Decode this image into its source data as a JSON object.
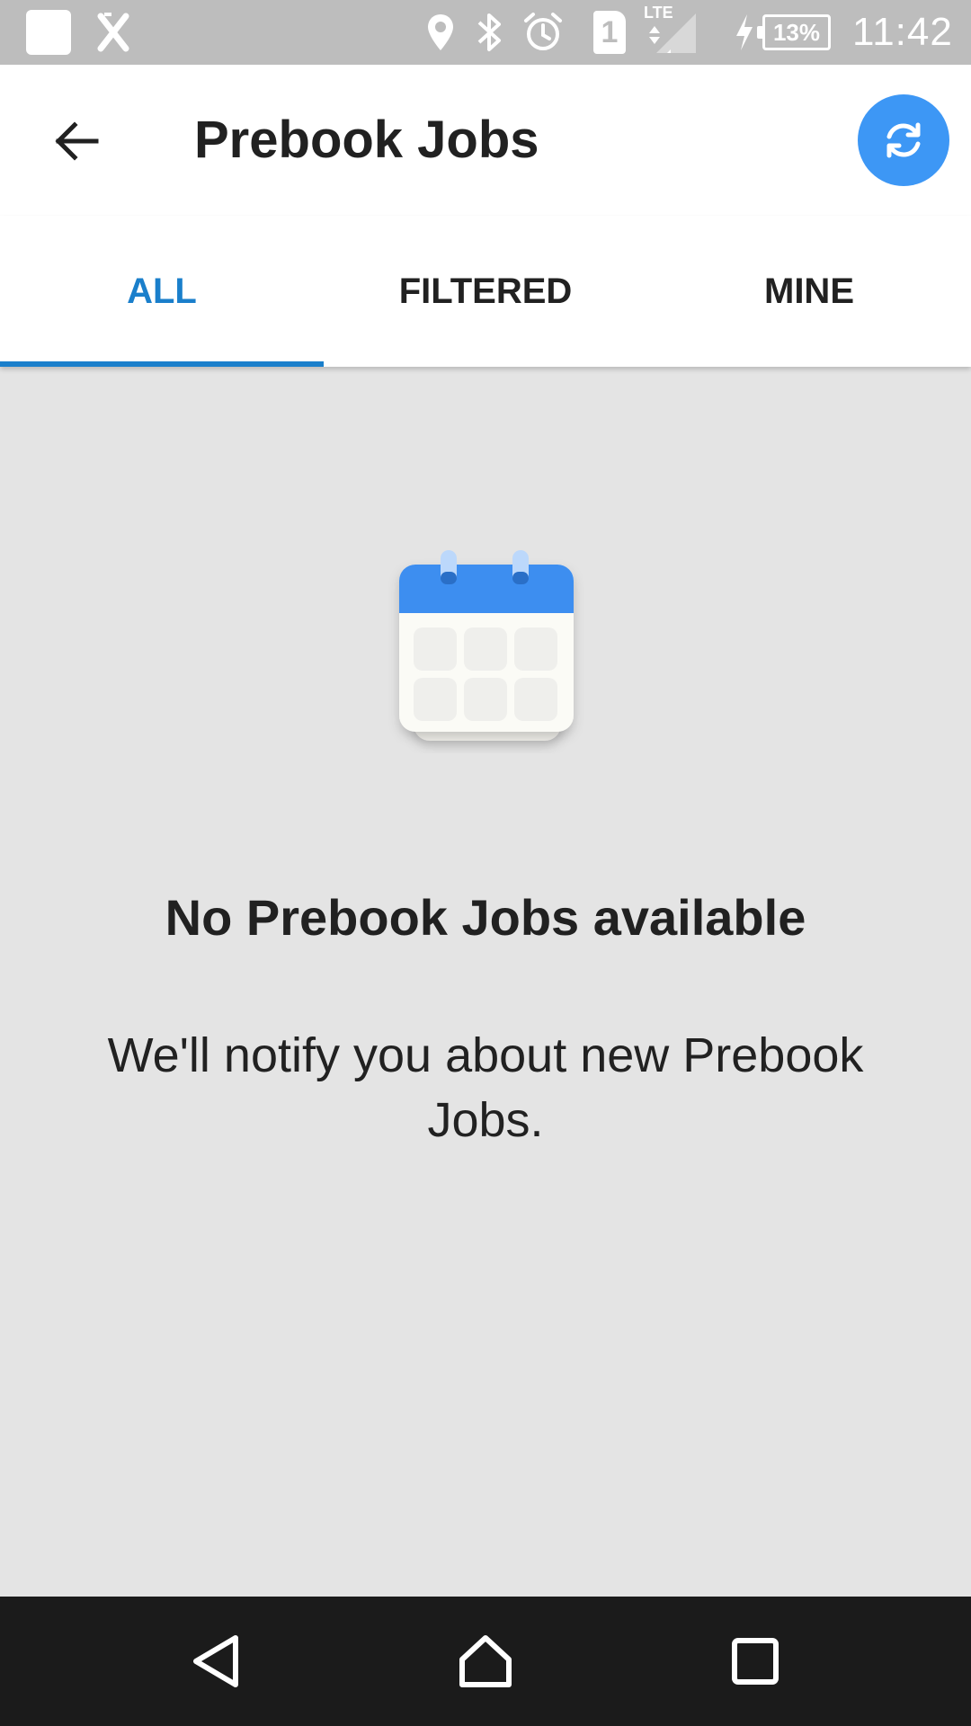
{
  "status_bar": {
    "time": "11:42",
    "battery_percent": "13%",
    "network_type": "LTE",
    "sim_slot": "1",
    "icons": [
      "notification-square-icon",
      "x-app-icon",
      "location-icon",
      "bluetooth-icon",
      "alarm-icon",
      "sim-icon",
      "signal-icon",
      "charging-icon",
      "battery-icon"
    ]
  },
  "app_bar": {
    "title": "Prebook Jobs",
    "back_icon": "arrow-back-icon",
    "refresh_icon": "refresh-icon",
    "refresh_color": "#3d97f5"
  },
  "tabs": [
    {
      "label": "ALL",
      "active": true
    },
    {
      "label": "FILTERED",
      "active": false
    },
    {
      "label": "MINE",
      "active": false
    }
  ],
  "accent_color": "#1a7fcb",
  "empty_state": {
    "icon": "calendar-icon",
    "title": "No Prebook Jobs available",
    "message": "We'll notify you about new Prebook Jobs."
  },
  "nav_bar": {
    "buttons": [
      "back-triangle-icon",
      "home-icon",
      "recents-square-icon"
    ]
  }
}
